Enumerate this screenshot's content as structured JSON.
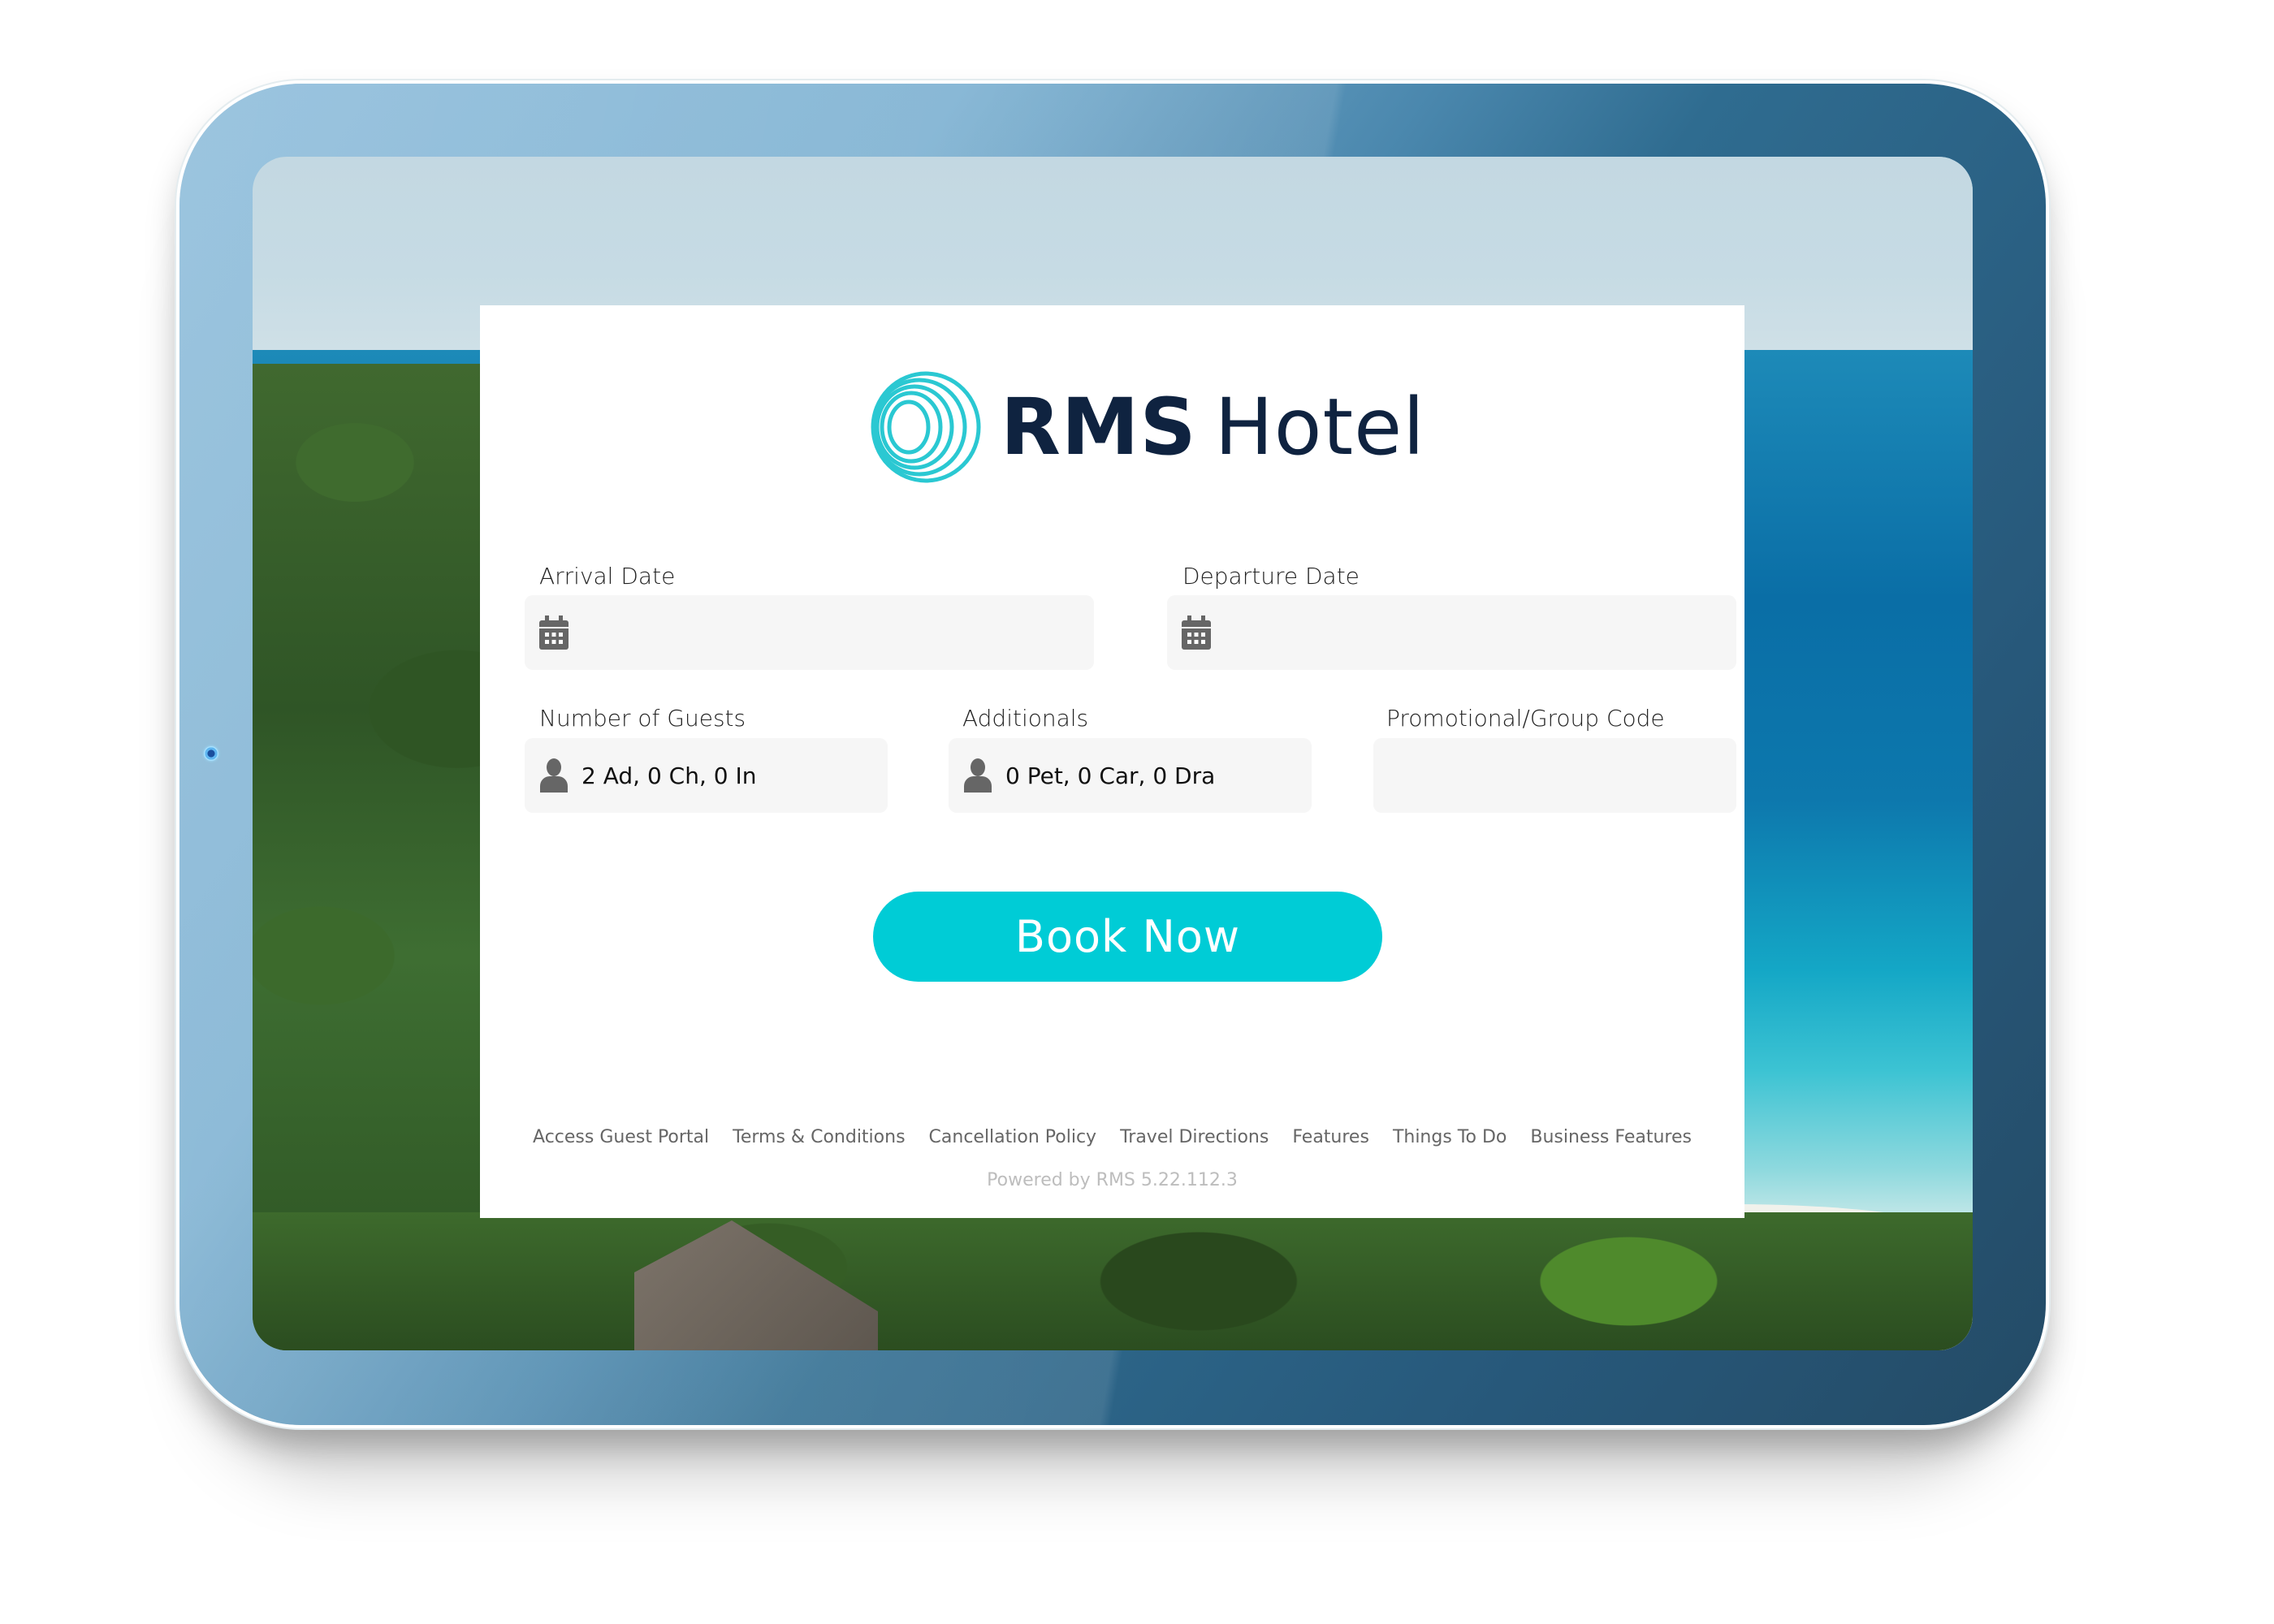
{
  "app": {
    "brand_name_bold": "RMS",
    "brand_name_light": "Hotel",
    "accent_color": "#00ccd6",
    "brand_text_color": "#0f2340",
    "logo_color": "#2ac8d2"
  },
  "form": {
    "arrival": {
      "label": "Arrival Date",
      "value": "",
      "icon": "calendar-icon"
    },
    "departure": {
      "label": "Departure Date",
      "value": "",
      "icon": "calendar-icon"
    },
    "guests": {
      "label": "Number of Guests",
      "value": "2 Ad, 0 Ch, 0 In",
      "icon": "person-icon"
    },
    "additionals": {
      "label": "Additionals",
      "value": "0 Pet, 0 Car, 0 Dra",
      "icon": "person-icon"
    },
    "promo": {
      "label": "Promotional/Group Code",
      "value": ""
    },
    "submit_label": "Book Now"
  },
  "footer": {
    "links": [
      "Access Guest Portal",
      "Terms & Conditions",
      "Cancellation Policy",
      "Travel Directions",
      "Features",
      "Things To Do",
      "Business Features"
    ],
    "powered_by": "Powered by RMS 5.22.112.3"
  }
}
